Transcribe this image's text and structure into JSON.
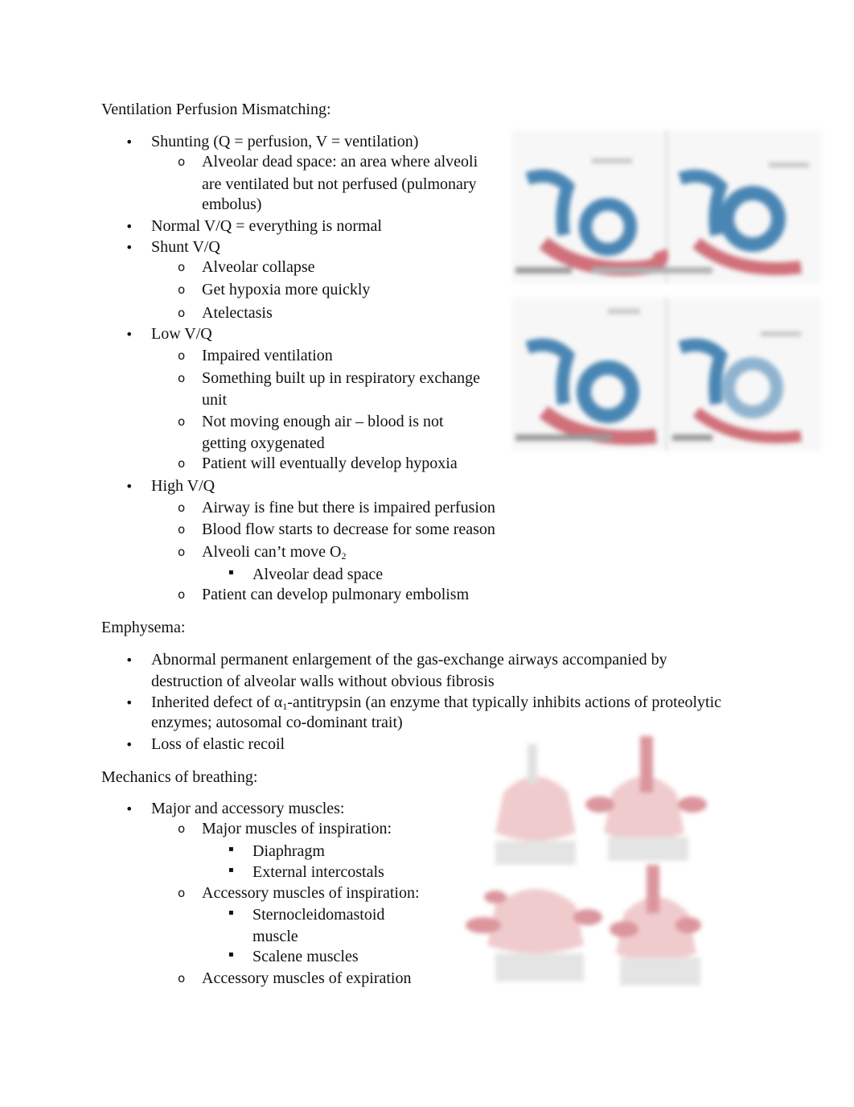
{
  "sections": [
    {
      "heading": "Ventilation Perfusion Mismatching:",
      "items": [
        {
          "level": 1,
          "lines": [
            "Shunting (Q = perfusion, V = ventilation)"
          ]
        },
        {
          "level": 2,
          "lines": [
            "Alveolar dead space: an area where alveoli",
            "are ventilated but not perfused (pulmonary",
            "embolus)"
          ]
        },
        {
          "level": 1,
          "lines": [
            "Normal V/Q = everything is normal"
          ]
        },
        {
          "level": 1,
          "lines": [
            "Shunt V/Q"
          ]
        },
        {
          "level": 2,
          "lines": [
            "Alveolar collapse"
          ]
        },
        {
          "level": 2,
          "lines": [
            "Get hypoxia more quickly"
          ]
        },
        {
          "level": 2,
          "lines": [
            "Atelectasis"
          ]
        },
        {
          "level": 1,
          "lines": [
            "Low V/Q"
          ]
        },
        {
          "level": 2,
          "lines": [
            "Impaired ventilation"
          ]
        },
        {
          "level": 2,
          "lines": [
            "Something built up in respiratory exchange",
            "unit"
          ]
        },
        {
          "level": 2,
          "lines": [
            "Not moving enough air – blood is not",
            "getting oxygenated"
          ]
        },
        {
          "level": 2,
          "lines": [
            "Patient will eventually develop hypoxia"
          ]
        },
        {
          "level": 1,
          "lines": [
            "High V/Q"
          ]
        },
        {
          "level": 2,
          "lines": [
            "Airway is fine but there is impaired perfusion"
          ]
        },
        {
          "level": 2,
          "lines": [
            "Blood flow starts to decrease for some reason"
          ]
        },
        {
          "level": 2,
          "lines": [
            "Alveoli can’t move O",
            "2"
          ],
          "subscript": true
        },
        {
          "level": 3,
          "lines": [
            "Alveolar dead space"
          ]
        },
        {
          "level": 2,
          "lines": [
            "Patient can develop pulmonary embolism"
          ]
        }
      ]
    },
    {
      "heading": "Emphysema:",
      "items": [
        {
          "level": 1,
          "lines": [
            "Abnormal permanent enlargement of the gas-exchange airways accompanied by",
            "destruction of alveolar walls without obvious fibrosis"
          ]
        },
        {
          "level": 1,
          "lines": [
            "Inherited defect of α",
            "1",
            "-antitrypsin (an enzyme that typically inhibits actions of proteolytic",
            "enzymes; autosomal co-dominant trait)"
          ],
          "subscript": true
        },
        {
          "level": 1,
          "lines": [
            "Loss of elastic recoil"
          ]
        }
      ]
    },
    {
      "heading": "Mechanics of breathing:",
      "items": [
        {
          "level": 1,
          "lines": [
            "Major and accessory muscles:"
          ]
        },
        {
          "level": 2,
          "lines": [
            "Major muscles of inspiration:"
          ]
        },
        {
          "level": 3,
          "lines": [
            "Diaphragm"
          ]
        },
        {
          "level": 3,
          "lines": [
            "External intercostals"
          ]
        },
        {
          "level": 2,
          "lines": [
            "Accessory muscles of inspiration:"
          ]
        },
        {
          "level": 3,
          "lines": [
            "Sternocleidomastoid",
            "muscle"
          ]
        },
        {
          "level": 3,
          "lines": [
            "Scalene muscles"
          ]
        },
        {
          "level": 2,
          "lines": [
            "Accessory muscles of expiration"
          ]
        }
      ]
    }
  ],
  "bullets": {
    "level1": "•",
    "level2": "o",
    "level3": "▪"
  },
  "figures": {
    "vq_diagram": {
      "description": "blurred V/Q mismatch alveolus diagrams (4 panels)",
      "airway_color": "#4a86b4",
      "capillary_color": "#d0707a"
    },
    "muscles_diagram": {
      "description": "blurred respiratory muscle illustrations (4 panels)",
      "muscle_color": "#d98a93"
    }
  }
}
